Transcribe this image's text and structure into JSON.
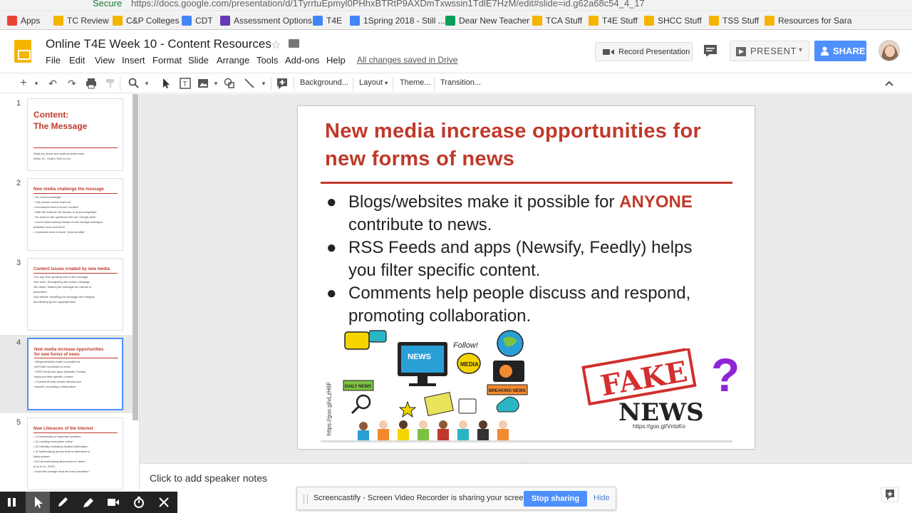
{
  "browser": {
    "secure_label": "Secure",
    "url": "https://docs.google.com/presentation/d/1TyrrtuEpmyl0PHhxBTRtP9AXDmTxwssin1TdlE7HzM/edit#slide=id.g62a68c54_4_17",
    "bookmarks": [
      {
        "label": "Apps",
        "color": "#ea4335"
      },
      {
        "label": "TC Review",
        "color": "#f4b400"
      },
      {
        "label": "C&P Colleges",
        "color": "#f4b400"
      },
      {
        "label": "CDT",
        "color": "#4285f4"
      },
      {
        "label": "Assessment Options",
        "color": "#673ab7"
      },
      {
        "label": "T4E",
        "color": "#4285f4"
      },
      {
        "label": "1Spring 2018 - Still ...",
        "color": "#4285f4"
      },
      {
        "label": "Dear New Teacher",
        "color": "#0f9d58"
      },
      {
        "label": "TCA Stuff",
        "color": "#f4b400"
      },
      {
        "label": "T4E Stuff",
        "color": "#f4b400"
      },
      {
        "label": "SHCC Stuff",
        "color": "#f4b400"
      },
      {
        "label": "TSS Stuff",
        "color": "#f4b400"
      },
      {
        "label": "Resources for Sara",
        "color": "#f4b400"
      }
    ]
  },
  "header": {
    "title": "Online T4E Week 10 - Content Resources",
    "menu": [
      "File",
      "Edit",
      "View",
      "Insert",
      "Format",
      "Slide",
      "Arrange",
      "Tools",
      "Add-ons",
      "Help"
    ],
    "saved_status": "All changes saved in Drive",
    "record_label": "Record Presentation",
    "present_label": "PRESENT",
    "share_label": "SHARE"
  },
  "toolbar": {
    "background": "Background...",
    "layout": "Layout",
    "theme": "Theme...",
    "transition": "Transition..."
  },
  "filmstrip": [
    {
      "num": "1",
      "title": "Content:\nThe Message",
      "lines": [
        "What you teach and what students learn",
        "Week 10 - Online Tech for Ed"
      ]
    },
    {
      "num": "2",
      "title": "New media challenge the message",
      "lines": [
        "• So much knowledge",
        "   ◦ One person cannot learn all",
        "• Decreased need to know \"content\"",
        "   ◦ With the Internet, the answer is at your fingertips",
        "   ◦ No need to ask questions that are \"Google-able\"",
        "   ◦ Just-in-time training instead of cold storage training is",
        "     available more and more",
        "• Increased need to know \"process skills\""
      ]
    },
    {
      "num": "3",
      "title": "Content issues created by new media",
      "lines": [
        "•Too big: Ever growing size of the message",
        "•Not seen: Recognizing the hidden message",
        "•No depth: Making the message too narrow or",
        "   prescribed",
        "•Not ethical: Handling the message with integrity",
        "   and abiding by the copyright laws"
      ]
    },
    {
      "num": "4",
      "title": "New media increase opportunities\nfor new forms of news",
      "lines": [
        "• Blogs/websites make it possible for",
        "  ANYONE contribute to news.",
        "• RSS Feeds and apps (Newsify, Feedly)",
        "  helps you filter specific content.",
        "• Comments help people discuss and",
        "  respond, promoting collaboration."
      ]
    },
    {
      "num": "5",
      "title": "New Literacies of the Internet",
      "lines": [
        "• 1) Developing an important question",
        "• 2) Locating information online",
        "• 3) Critically evaluating located information",
        "• 4) Synthesizing across texts to determine a",
        "   likely answer",
        "• 5) Communicating discoveries to others",
        "   (Leu et al., 2007)",
        "• Does this change what we teach students?"
      ]
    }
  ],
  "slide": {
    "title": "New media increase opportunities for new forms of news",
    "bullets": [
      {
        "pre": "Blogs/websites make it possible for",
        "emph": "ANYONE",
        "post": " contribute to news."
      },
      {
        "pre": "RSS Feeds and apps (Newsify, Feedly) helps you filter specific content.",
        "emph": "",
        "post": ""
      },
      {
        "pre": "Comments help people discuss and respond, promoting collaboration.",
        "emph": "",
        "post": ""
      }
    ],
    "image_credit_left": "https://goo.gl/vLzH6F",
    "image_credit_right": "https://goo.gl/VntsKo",
    "collage_words": {
      "news": "NEWS",
      "follow": "Follow!",
      "media": "MEDIA",
      "daily": "DAILY NEWS",
      "breaking": "BREAKING NEWS"
    },
    "fake_stamp": "FAKE",
    "fake_news": "NEWS",
    "question": "?"
  },
  "notes_placeholder": "Click to add speaker notes",
  "screencastify": {
    "message": "Screencastify - Screen Video Recorder is sharing your screen.",
    "stop": "Stop sharing",
    "hide": "Hide"
  },
  "colors": {
    "accent": "#c0392b",
    "share": "#4d90fe",
    "selection": "#4d90fe"
  }
}
